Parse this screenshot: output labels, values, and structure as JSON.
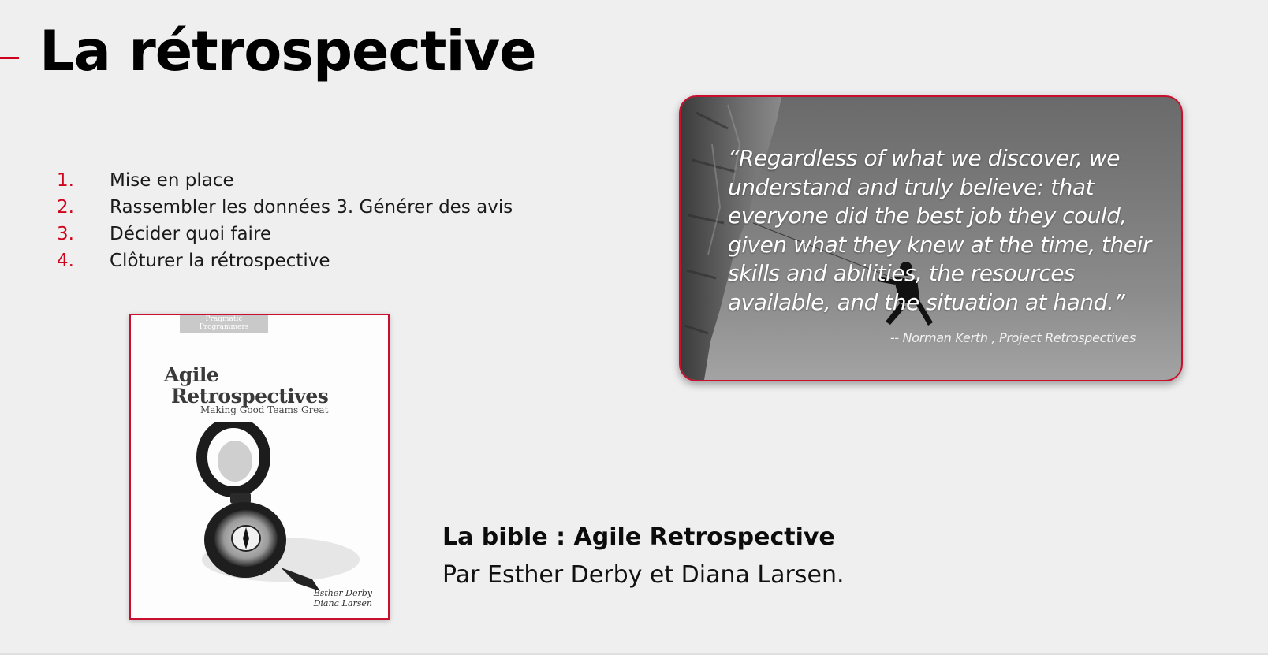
{
  "slide": {
    "title": "La rétrospective",
    "accent_color": "#d0021b",
    "background_color": "#efefef"
  },
  "steps": [
    {
      "number": "1.",
      "text": "Mise en place"
    },
    {
      "number": "2.",
      "text": "Rassembler les données 3. Générer des avis"
    },
    {
      "number": "3.",
      "text": "Décider quoi faire"
    },
    {
      "number": "4.",
      "text": "Clôturer la rétrospective"
    }
  ],
  "quote_card": {
    "quote": "“Regardless of what we discover, we understand and truly believe: that everyone did the best job they could, given what they knew at the time, their skills and abilities, the resources available, and the situation at hand.”",
    "attribution": "-- Norman Kerth , Project Retrospectives",
    "image_subject": "climber-on-cliff"
  },
  "book_cover": {
    "publisher": "Pragmatic Programmers",
    "title_line1": "Agile",
    "title_line2": "Retrospectives",
    "subtitle": "Making Good Teams Great",
    "author1": "Esther Derby",
    "author2": "Diana Larsen",
    "image_subject": "compass-icon"
  },
  "bible": {
    "title": "La bible : Agile Retrospective",
    "authors": "Par Esther Derby et Diana Larsen."
  }
}
